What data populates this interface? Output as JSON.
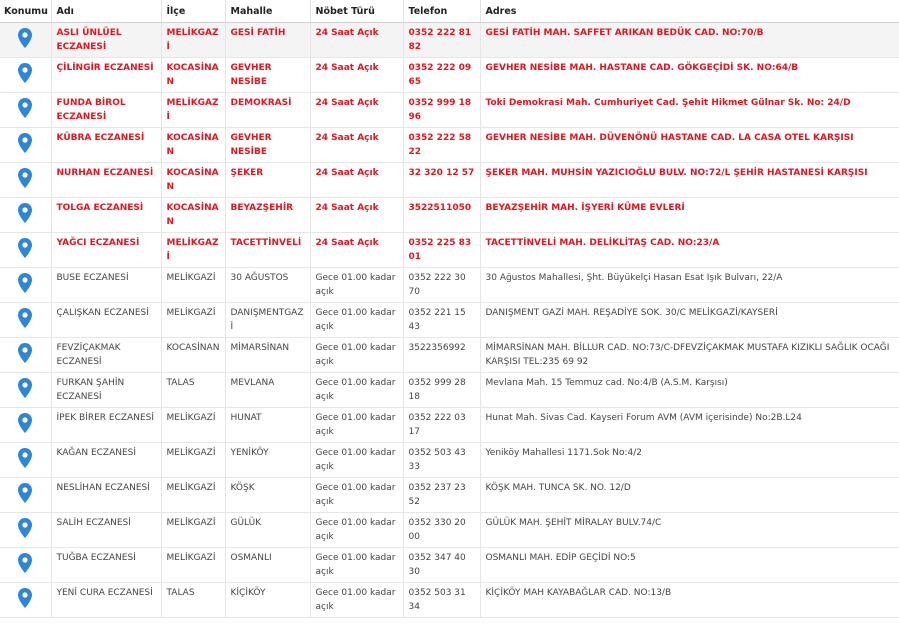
{
  "headers": {
    "konum": "Konumu",
    "adi": "Adı",
    "ilce": "İlçe",
    "mahalle": "Mahalle",
    "nobet": "Nöbet Türü",
    "telefon": "Telefon",
    "adres": "Adres"
  },
  "colors": {
    "on_duty": "#e8141e",
    "pin": "#2f86d6",
    "text": "#444444"
  },
  "pin_icon": "map-marker-icon",
  "rows": [
    {
      "adi": "ASLI ÜNLÜEL ECZANESİ",
      "ilce": "MELİKGAZİ",
      "mahalle": "GESİ FATİH",
      "nobet": "24 Saat Açık",
      "telefon": "0352 222 81 82",
      "adres": "GESİ FATİH MAH. SAFFET ARIKAN BEDÜK CAD. NO:70/B",
      "on_duty": true
    },
    {
      "adi": "ÇİLİNGİR ECZANESİ",
      "ilce": "KOCASİNAN",
      "mahalle": "GEVHER NESİBE",
      "nobet": "24 Saat Açık",
      "telefon": "0352 222 09 65",
      "adres": "GEVHER NESİBE MAH. HASTANE CAD. GÖKGEÇİDİ SK. NO:64/B",
      "on_duty": true
    },
    {
      "adi": "FUNDA BİROL ECZANESİ",
      "ilce": "MELİKGAZİ",
      "mahalle": "DEMOKRASİ",
      "nobet": "24 Saat Açık",
      "telefon": "0352 999 18 96",
      "adres": "Toki Demokrasi Mah. Cumhuriyet Cad. Şehit Hikmet Gülnar Sk. No: 24/D",
      "on_duty": true
    },
    {
      "adi": "KÜBRA ECZANESİ",
      "ilce": "KOCASİNAN",
      "mahalle": "GEVHER NESİBE",
      "nobet": "24 Saat Açık",
      "telefon": "0352 222 58 22",
      "adres": "GEVHER NESİBE MAH. DÜVENÖNÜ HASTANE CAD. LA CASA OTEL KARŞISI",
      "on_duty": true
    },
    {
      "adi": "NURHAN ECZANESİ",
      "ilce": "KOCASİNAN",
      "mahalle": "ŞEKER",
      "nobet": "24 Saat Açık",
      "telefon": "32 320 12 57",
      "adres": "ŞEKER MAH. MUHSİN YAZICIOĞLU BULV. NO:72/L ŞEHİR HASTANESİ KARŞISI",
      "on_duty": true
    },
    {
      "adi": "TOLGA ECZANESİ",
      "ilce": "KOCASİNAN",
      "mahalle": "BEYAZŞEHİR",
      "nobet": "24 Saat Açık",
      "telefon": "3522511050",
      "adres": "BEYAZŞEHİR MAH. İŞYERİ KÜME EVLERİ",
      "on_duty": true
    },
    {
      "adi": "YAĞCI ECZANESİ",
      "ilce": "MELİKGAZİ",
      "mahalle": "TACETTİNVELİ",
      "nobet": "24 Saat Açık",
      "telefon": "0352 225 83 01",
      "adres": "TACETTİNVELİ MAH. DELİKLİTAŞ CAD. NO:23/A",
      "on_duty": true
    },
    {
      "adi": "BUSE ECZANESİ",
      "ilce": "MELİKGAZİ",
      "mahalle": "30 AĞUSTOS",
      "nobet": "Gece 01.00 kadar açık",
      "telefon": "0352 222 30 70",
      "adres": "30 Ağustos Mahallesi, Şht. Büyükelçi Hasan Esat Işık Bulvarı, 22/A",
      "on_duty": false
    },
    {
      "adi": "ÇALIŞKAN ECZANESİ",
      "ilce": "MELİKGAZİ",
      "mahalle": "DANIŞMENTGAZİ",
      "nobet": "Gece 01.00 kadar açık",
      "telefon": "0352 221 15 43",
      "adres": "DANIŞMENT GAZİ MAH. REŞADİYE SOK. 30/C MELİKGAZİ/KAYSERİ",
      "on_duty": false
    },
    {
      "adi": "FEVZİÇAKMAK ECZANESİ",
      "ilce": "KOCASİNAN",
      "mahalle": "MİMARSİNAN",
      "nobet": "Gece 01.00 kadar açık",
      "telefon": "3522356992",
      "adres": "MİMARSİNAN MAH. BİLLUR CAD. NO:73/C-DFEVZİÇAKMAK MUSTAFA KIZIKLI SAĞLIK OCAĞI KARŞISI TEL:235 69 92",
      "on_duty": false
    },
    {
      "adi": "FURKAN ŞAHİN ECZANESİ",
      "ilce": "TALAS",
      "mahalle": "MEVLANA",
      "nobet": "Gece 01.00 kadar açık",
      "telefon": "0352 999 28 18",
      "adres": "Mevlana Mah. 15 Temmuz cad. No:4/B (A.S.M. Karşısı)",
      "on_duty": false
    },
    {
      "adi": "İPEK BİRER ECZANESİ",
      "ilce": "MELİKGAZİ",
      "mahalle": "HUNAT",
      "nobet": "Gece 01.00 kadar açık",
      "telefon": "0352 222 03 17",
      "adres": "Hunat Mah. Sivas Cad. Kayseri Forum AVM (AVM içerisinde) No:2B.L24",
      "on_duty": false
    },
    {
      "adi": "KAĞAN ECZANESİ",
      "ilce": "MELİKGAZİ",
      "mahalle": "YENİKÖY",
      "nobet": "Gece 01.00 kadar açık",
      "telefon": "0352 503 43 33",
      "adres": "Yeniköy Mahallesi 1171.Sok No:4/2",
      "on_duty": false
    },
    {
      "adi": "NESLİHAN ECZANESİ",
      "ilce": "MELİKGAZİ",
      "mahalle": "KÖŞK",
      "nobet": "Gece 01.00 kadar açık",
      "telefon": "0352 237 23 52",
      "adres": "KÖŞK MAH. TUNCA SK. NO. 12/D",
      "on_duty": false
    },
    {
      "adi": "SALİH ECZANESİ",
      "ilce": "MELİKGAZİ",
      "mahalle": "GÜLÜK",
      "nobet": "Gece 01.00 kadar açık",
      "telefon": "0352 330 20 00",
      "adres": "GÜLÜK MAH. ŞEHİT MİRALAY BULV.74/C",
      "on_duty": false
    },
    {
      "adi": "TUĞBA ECZANESİ",
      "ilce": "MELİKGAZİ",
      "mahalle": "OSMANLI",
      "nobet": "Gece 01.00 kadar açık",
      "telefon": "0352 347 40 30",
      "adres": "OSMANLI MAH. EDİP GEÇİDİ NO:5",
      "on_duty": false
    },
    {
      "adi": "YENİ CURA ECZANESİ",
      "ilce": "TALAS",
      "mahalle": "KİÇİKÖY",
      "nobet": "Gece 01.00 kadar açık",
      "telefon": "0352 503 31 34",
      "adres": "KİÇİKÖY MAH KAYABAĞLAR CAD. NO:13/B",
      "on_duty": false
    }
  ]
}
